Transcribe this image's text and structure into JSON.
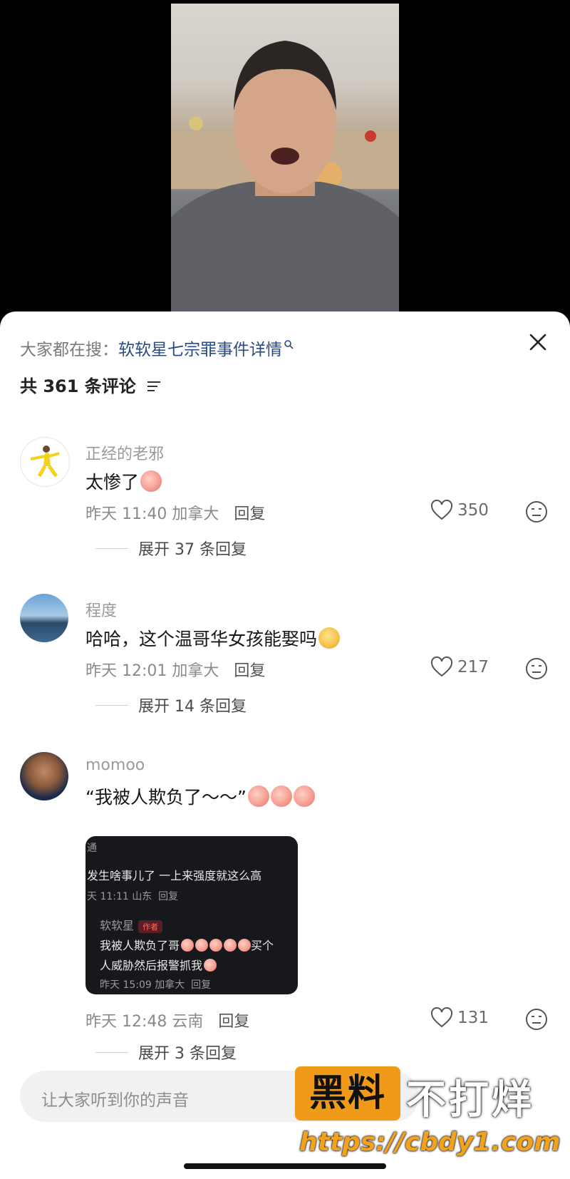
{
  "search": {
    "prefix": "大家都在搜：",
    "keyword": "软软星七宗罪事件详情"
  },
  "comments_header": {
    "count_label": "共 361 条评论"
  },
  "comments": [
    {
      "username": "正经的老邪",
      "text": "太惨了",
      "time": "昨天 11:40",
      "location": "加拿大",
      "reply_label": "回复",
      "likes": "350",
      "expand_label": "展开 37 条回复"
    },
    {
      "username": "程度",
      "text": "哈哈，这个温哥华女孩能娶吗",
      "time": "昨天 12:01",
      "location": "加拿大",
      "reply_label": "回复",
      "likes": "217",
      "expand_label": "展开 14 条回复"
    },
    {
      "username": "momoo",
      "text": "“我被人欺负了～～”",
      "time": "昨天 12:48",
      "location": "云南",
      "reply_label": "回复",
      "likes": "131",
      "expand_label": "展开 3 条回复",
      "screenshot": {
        "line0": "通",
        "line1": "发生啥事儿了 一上来强度就这么高",
        "line2_meta": "天 11:11 山东",
        "line2_reply": "回复",
        "author": "软软星",
        "author_badge": "作者",
        "line3": "我被人欺负了哥",
        "line3_tail": "买个",
        "line4": "人威胁然后报警抓我",
        "line5_meta": "昨天 15:09 加拿大",
        "line5_reply": "回复"
      }
    }
  ],
  "input": {
    "placeholder": "让大家听到你的声音"
  },
  "watermark": {
    "black_label": "黑料",
    "white_label": "不打烊",
    "url": "https://cbdy1.com"
  }
}
